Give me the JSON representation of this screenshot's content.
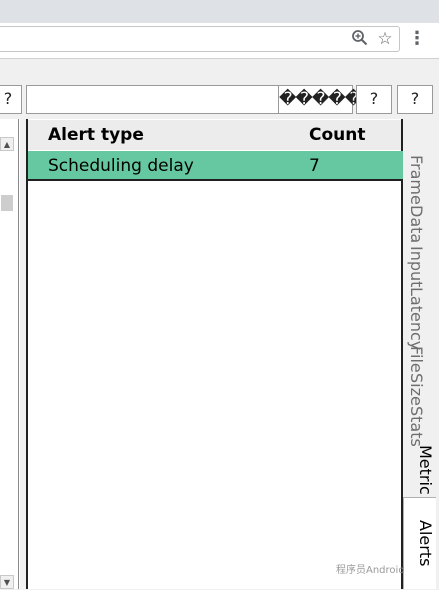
{
  "browser": {
    "icons": [
      "zoom-icon",
      "star-icon",
      "menu-icon"
    ]
  },
  "toolbar": {
    "left_button": "?",
    "filter_value": "",
    "replacement_glyphs": "������",
    "button_a": "?",
    "button_b": "?"
  },
  "table": {
    "headers": {
      "alert_type": "Alert type",
      "count": "Count"
    },
    "rows": [
      {
        "alert_type": "Scheduling delay",
        "count": "7"
      }
    ],
    "selected_row_color": "#66c8a0"
  },
  "tabs": {
    "frame_data": [
      "Frame",
      "Data"
    ],
    "input_latency": [
      "Input",
      "Latency"
    ],
    "file_size_stats": [
      "File",
      "Size",
      "Stats"
    ],
    "metrics": "Metric",
    "alerts": "Alerts",
    "active": "Alerts"
  },
  "watermark": "程序员Android"
}
